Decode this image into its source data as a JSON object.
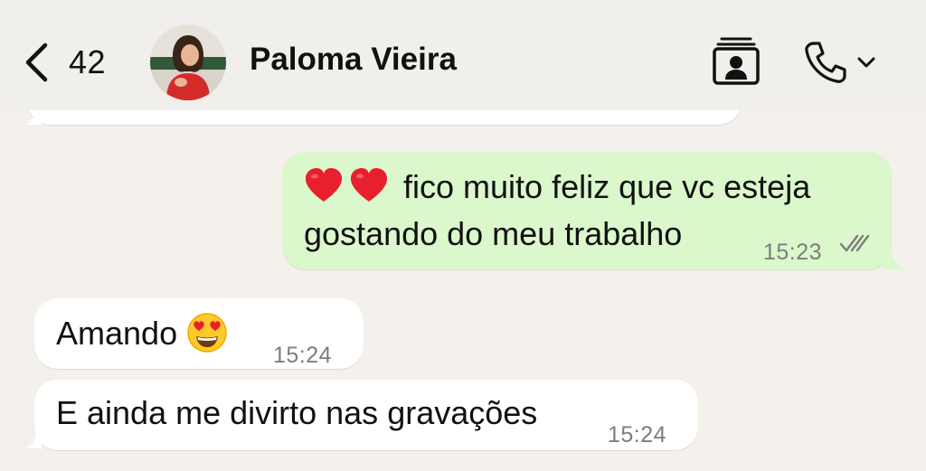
{
  "header": {
    "back_count": "42",
    "contact_name": "Paloma Vieira"
  },
  "colors": {
    "background": "#f4f1ec",
    "incoming_bubble": "#ffffff",
    "outgoing_bubble": "#dbf7cc",
    "timestamp": "#7d7d7d",
    "heart": "#e8202e"
  },
  "icons": {
    "back": "chevron-left-icon",
    "contact_card": "contact-card-icon",
    "call": "phone-icon",
    "call_menu": "chevron-down-icon",
    "read_receipt": "double-check-icon",
    "heart": "red-heart-emoji",
    "heart_eyes": "heart-eyes-emoji"
  },
  "messages": [
    {
      "direction": "out",
      "line1": "fico muito feliz que vc esteja",
      "line2": "gostando do meu trabalho",
      "time": "15:23",
      "status": "read"
    },
    {
      "direction": "in",
      "text": "Amando",
      "time": "15:24"
    },
    {
      "direction": "in",
      "text": "E ainda me divirto nas gravações",
      "time": "15:24"
    }
  ]
}
